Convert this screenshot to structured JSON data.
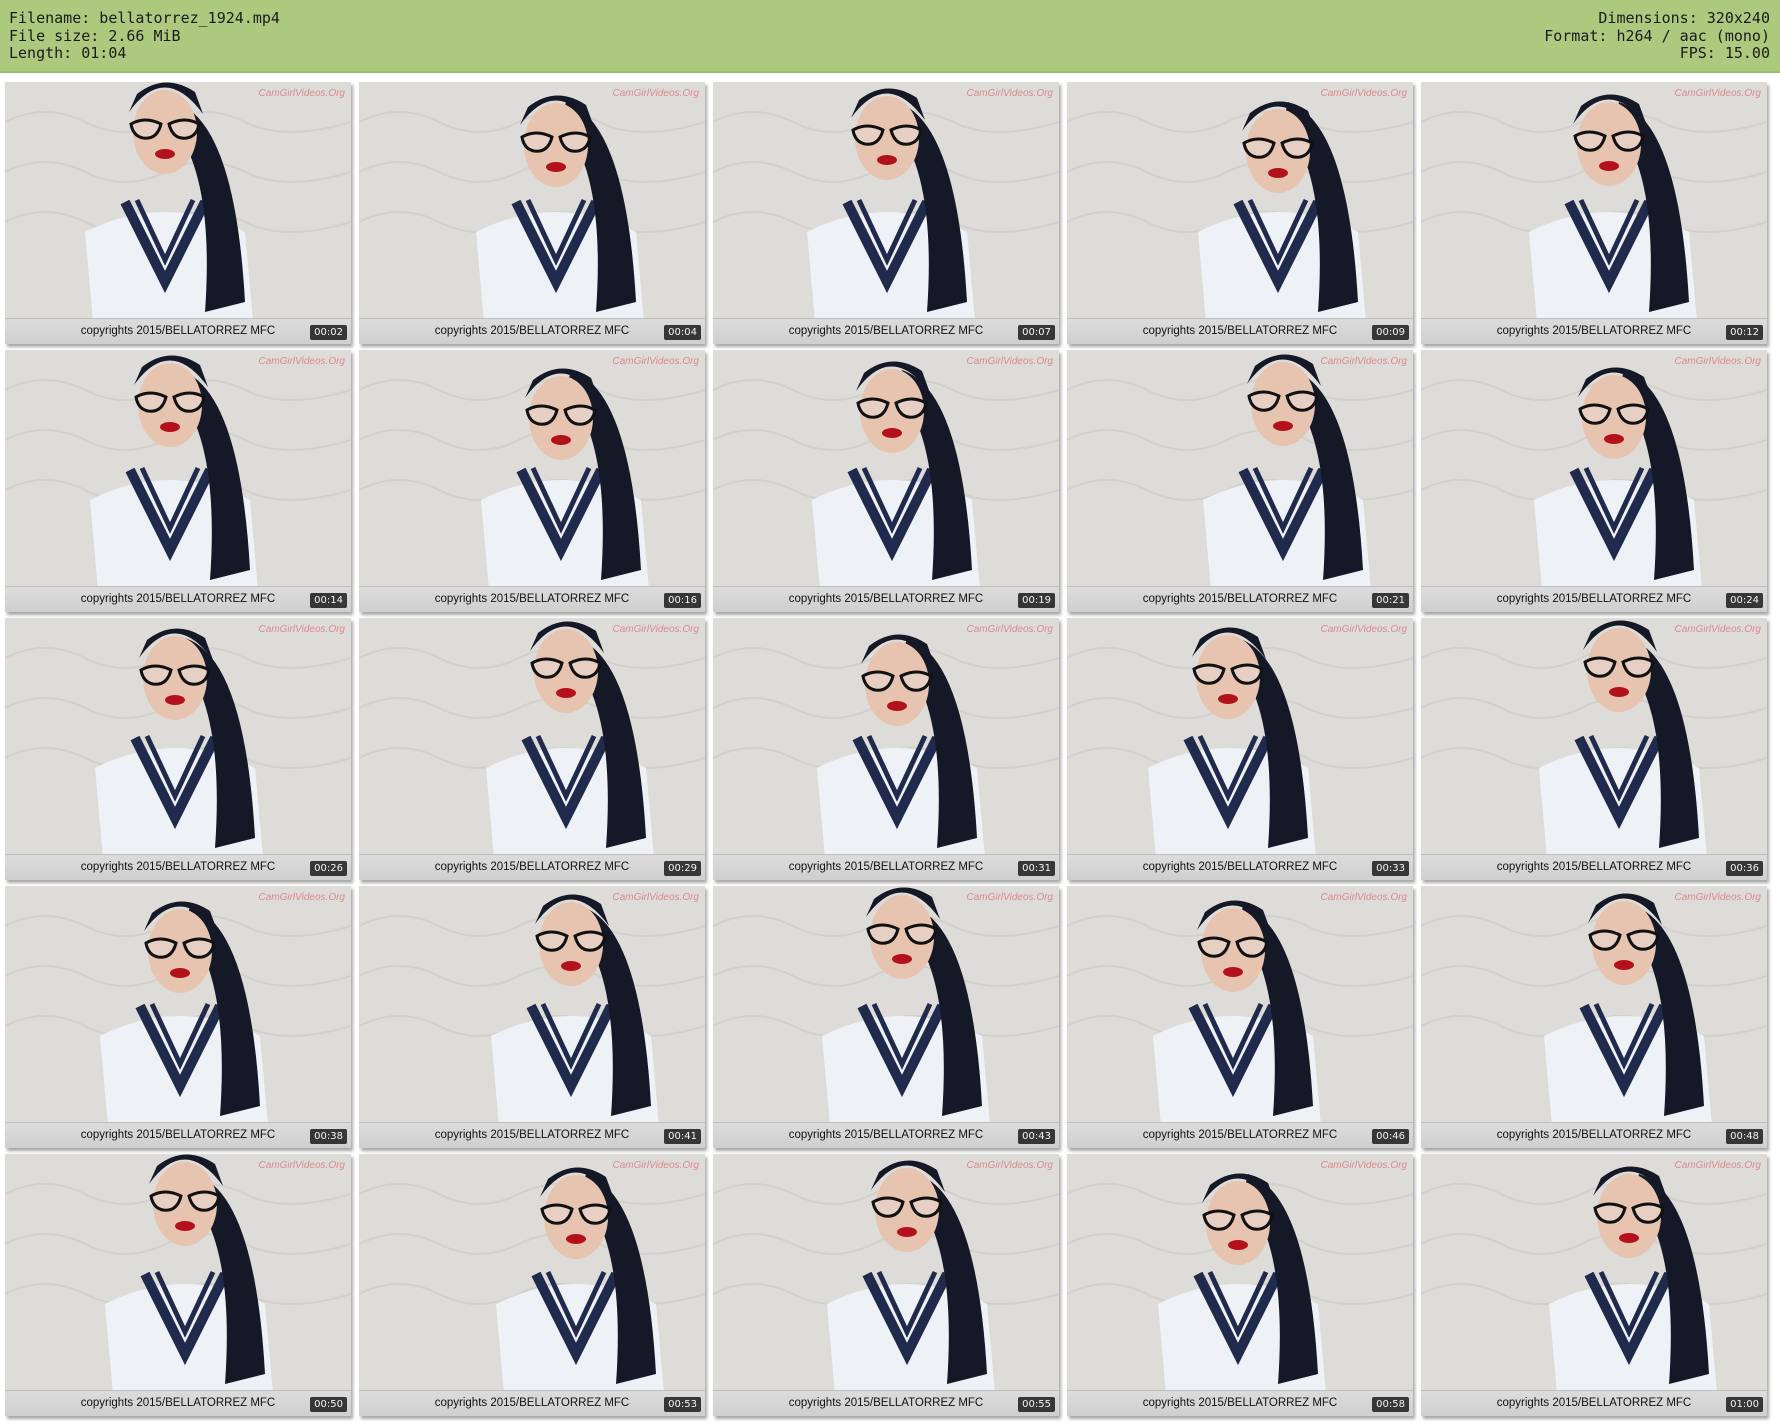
{
  "header": {
    "left": [
      "Filename: bellatorrez_1924.mp4",
      "File size: 2.66 MiB",
      "Length: 01:04"
    ],
    "right": [
      "Dimensions: 320x240",
      "Format: h264 / aac (mono)",
      "FPS: 15.00"
    ]
  },
  "thumbnails": {
    "caption": "copyrights 2015/BELLATORREZ MFC",
    "watermark": "CamGirlVideos.Org",
    "timestamps": [
      "00:02",
      "00:04",
      "00:07",
      "00:09",
      "00:12",
      "00:14",
      "00:16",
      "00:19",
      "00:21",
      "00:24",
      "00:26",
      "00:29",
      "00:31",
      "00:33",
      "00:36",
      "00:38",
      "00:41",
      "00:43",
      "00:46",
      "00:48",
      "00:50",
      "00:53",
      "00:55",
      "00:58",
      "01:00"
    ]
  },
  "colors": {
    "header_bg": "#acc97e",
    "hair": "#151826",
    "uniform": "#eef2f7",
    "collar_stripe": "#1f2a4d",
    "lips": "#b3121c",
    "skin": "#e7c4b0",
    "background": "#dedcd8"
  }
}
